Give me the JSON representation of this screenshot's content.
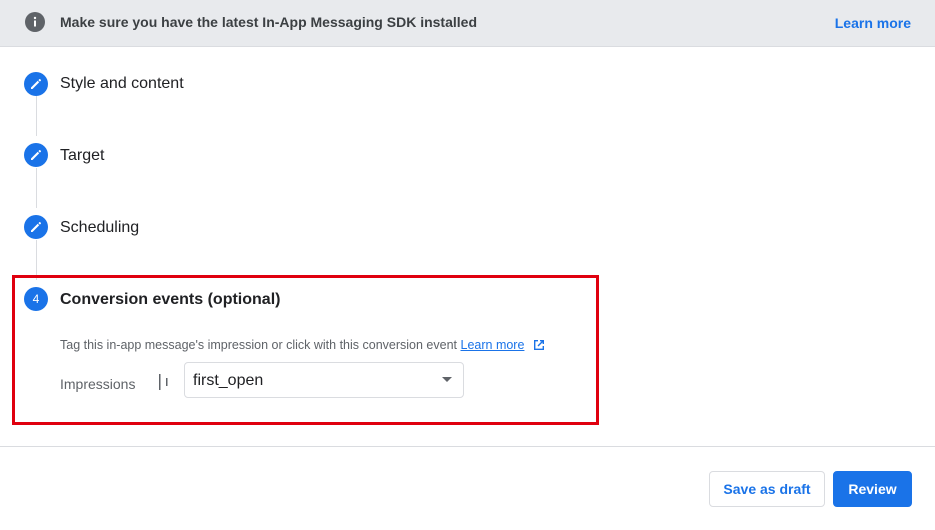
{
  "banner": {
    "icon": "info-icon",
    "message": "Make sure you have the latest In-App Messaging SDK installed",
    "link": "Learn more"
  },
  "steps": [
    {
      "title": "Style and content",
      "icon": "edit-pencil-icon"
    },
    {
      "title": "Target",
      "icon": "edit-pencil-icon"
    },
    {
      "title": "Scheduling",
      "icon": "edit-pencil-icon"
    },
    {
      "title": "Conversion events (optional)",
      "number": "4"
    }
  ],
  "conversion": {
    "helper_text": "Tag this in-app message's impression or click with this conversion event",
    "helper_link": "Learn more",
    "impressions_label": "Impressions",
    "selected_event": "first_open"
  },
  "footer": {
    "save_draft": "Save as draft",
    "review": "Review"
  },
  "colors": {
    "accent": "#1a73e8",
    "highlight": "#e0000f"
  }
}
